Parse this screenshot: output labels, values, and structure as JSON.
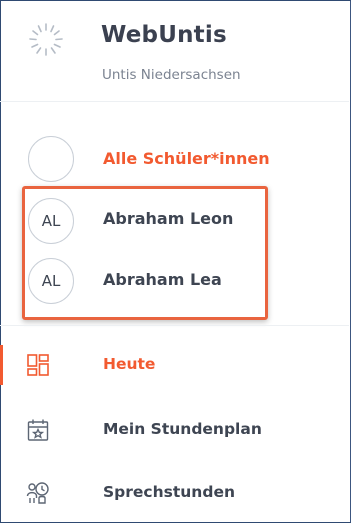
{
  "header": {
    "title": "WebUntis",
    "subtitle": "Untis Niedersachsen",
    "logo_icon": "webuntis-spinner-logo"
  },
  "students": {
    "all_label": "Alle Schüler*innen",
    "items": [
      {
        "initials": "AL",
        "name": "Abraham Leon"
      },
      {
        "initials": "AL",
        "name": "Abraham Lea"
      }
    ]
  },
  "nav": {
    "items": [
      {
        "label": "Heute",
        "icon": "dashboard-grid-icon",
        "active": true
      },
      {
        "label": "Mein Stundenplan",
        "icon": "calendar-star-icon",
        "active": false
      },
      {
        "label": "Sprechstunden",
        "icon": "people-clock-icon",
        "active": false
      }
    ]
  },
  "colors": {
    "accent": "#f25a30",
    "highlight_box": "#e9643f",
    "text": "#3e4552",
    "frame": "#2f4a72"
  }
}
